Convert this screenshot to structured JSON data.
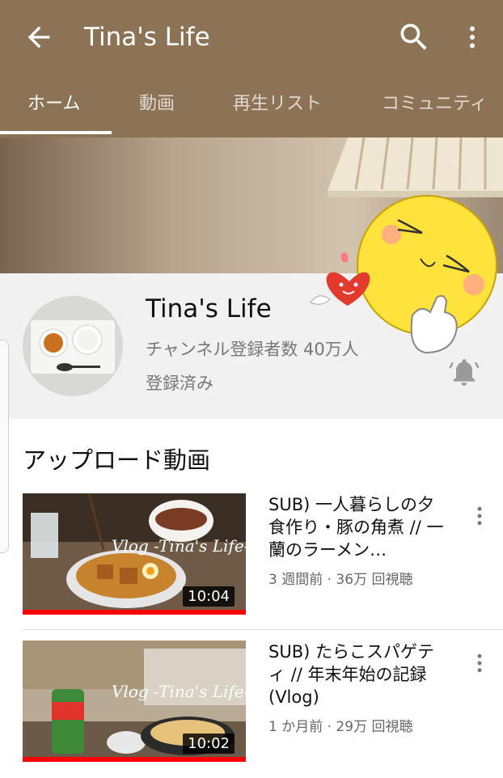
{
  "colors": {
    "appbar": "#8c7356",
    "header_bg": "#f1f1f1",
    "progress": "#ff0000"
  },
  "appbar": {
    "back_icon": "arrow-back-icon",
    "title": "Tina's Life",
    "search_icon": "search-icon",
    "more_icon": "more-vert-icon"
  },
  "tabs": [
    {
      "label": "ホーム",
      "active": true
    },
    {
      "label": "動画",
      "active": false
    },
    {
      "label": "再生リスト",
      "active": false
    },
    {
      "label": "コミュニティ",
      "active": false
    }
  ],
  "channel": {
    "name": "Tina's Life",
    "subscribers": "チャンネル登録者数 40万人",
    "status": "登録済み",
    "bell_icon": "bell-icon"
  },
  "section": {
    "title": "アップロード動画"
  },
  "videos": [
    {
      "title": "SUB) 一人暮らしの夕食作り・豚の角煮 // 一蘭のラーメン…",
      "meta": "3 週間前 · 36万 回視聴",
      "duration": "10:04",
      "thumb_text": "Vlog -Tina's Life-",
      "watched": 1.0
    },
    {
      "title": "SUB) たらこスパゲティ // 年末年始の記録 (Vlog)",
      "meta": "1 か月前 · 29万 回視聴",
      "duration": "10:02",
      "thumb_text": "Vlog -Tina's Life-",
      "watched": 1.0
    }
  ]
}
